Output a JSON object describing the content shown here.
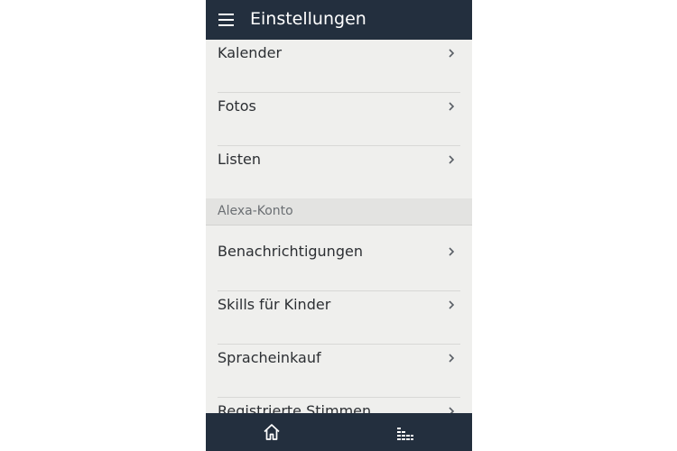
{
  "header": {
    "title": "Einstellungen",
    "menu_icon": "hamburger-menu-icon"
  },
  "settings": {
    "items_top": [
      {
        "label": "Kalender"
      },
      {
        "label": "Fotos"
      },
      {
        "label": "Listen"
      }
    ],
    "section": {
      "label": "Alexa-Konto"
    },
    "items_account": [
      {
        "label": "Benachrichtigungen"
      },
      {
        "label": "Skills für Kinder"
      },
      {
        "label": "Spracheinkauf"
      },
      {
        "label": "Registrierte Stimmen"
      }
    ],
    "chevron_icon": "chevron-right-icon"
  },
  "bottom_nav": {
    "tabs": [
      {
        "icon": "home-icon"
      },
      {
        "icon": "activity-bars-icon"
      }
    ]
  },
  "colors": {
    "header_bg": "#232f3e",
    "content_bg": "#efefed",
    "section_bg": "#e3e3e1",
    "text": "#2c2f33",
    "section_text": "#6b6f73"
  }
}
